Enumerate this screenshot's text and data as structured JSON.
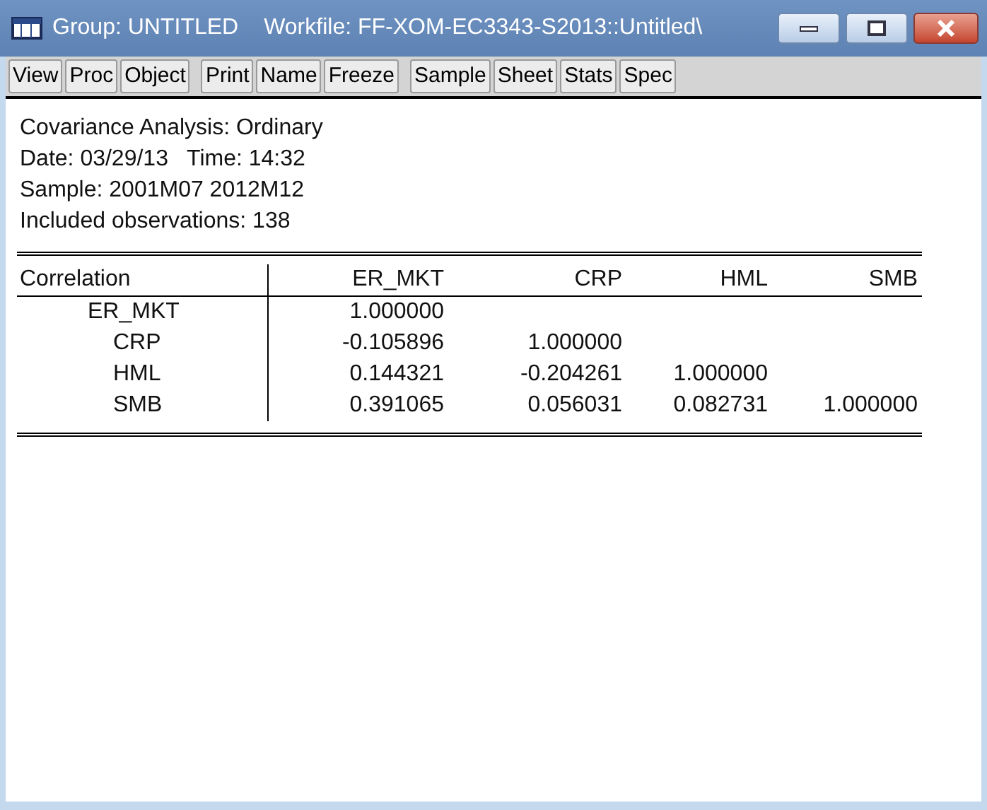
{
  "window": {
    "title": "Group: UNTITLED",
    "workfile": "Workfile: FF-XOM-EC3343-S2013::Untitled\\"
  },
  "toolbar": [
    [
      "View",
      "Proc",
      "Object"
    ],
    [
      "Print",
      "Name",
      "Freeze"
    ],
    [
      "Sample",
      "Sheet",
      "Stats",
      "Spec"
    ]
  ],
  "header": [
    "Covariance Analysis: Ordinary",
    "Date: 03/29/13   Time: 14:32",
    "Sample: 2001M07 2012M12",
    "Included observations: 138"
  ],
  "table": {
    "columns": [
      "Correlation",
      "ER_MKT",
      "CRP",
      "HML",
      "SMB"
    ],
    "rows": [
      [
        "ER_MKT",
        "1.000000",
        "",
        "",
        ""
      ],
      [
        "CRP",
        "-0.105896",
        "1.000000",
        "",
        ""
      ],
      [
        "HML",
        "0.144321",
        "-0.204261",
        "1.000000",
        ""
      ],
      [
        "SMB",
        "0.391065",
        "0.056031",
        "0.082731",
        "1.000000"
      ]
    ]
  }
}
